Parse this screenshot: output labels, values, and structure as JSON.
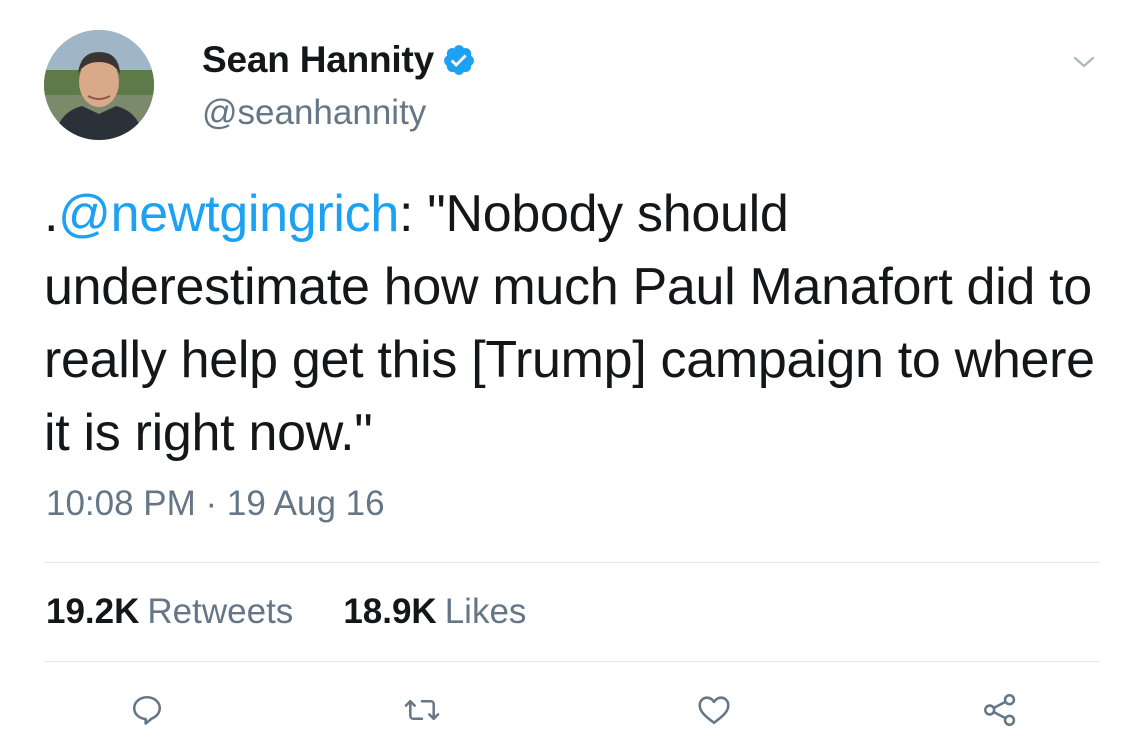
{
  "author": {
    "display_name": "Sean Hannity",
    "handle": "@seanhannity",
    "verified": true
  },
  "tweet": {
    "prefix": ".",
    "mention": "@newtgingrich",
    "body": ": \"Nobody should underestimate how much Paul Manafort did to really help get this [Trump] campaign to where it is right now.\"",
    "timestamp": "10:08 PM · 19 Aug 16"
  },
  "stats": {
    "retweets_count": "19.2K",
    "retweets_label": "Retweets",
    "likes_count": "18.9K",
    "likes_label": "Likes"
  },
  "actions": {
    "reply_icon": "reply-icon",
    "retweet_icon": "retweet-icon",
    "like_icon": "heart-icon",
    "share_icon": "share-icon"
  },
  "colors": {
    "link": "#1da1f2",
    "secondary_text": "#657786",
    "primary_text": "#14171a",
    "divider": "#e1e8ed",
    "icon": "#657786"
  }
}
